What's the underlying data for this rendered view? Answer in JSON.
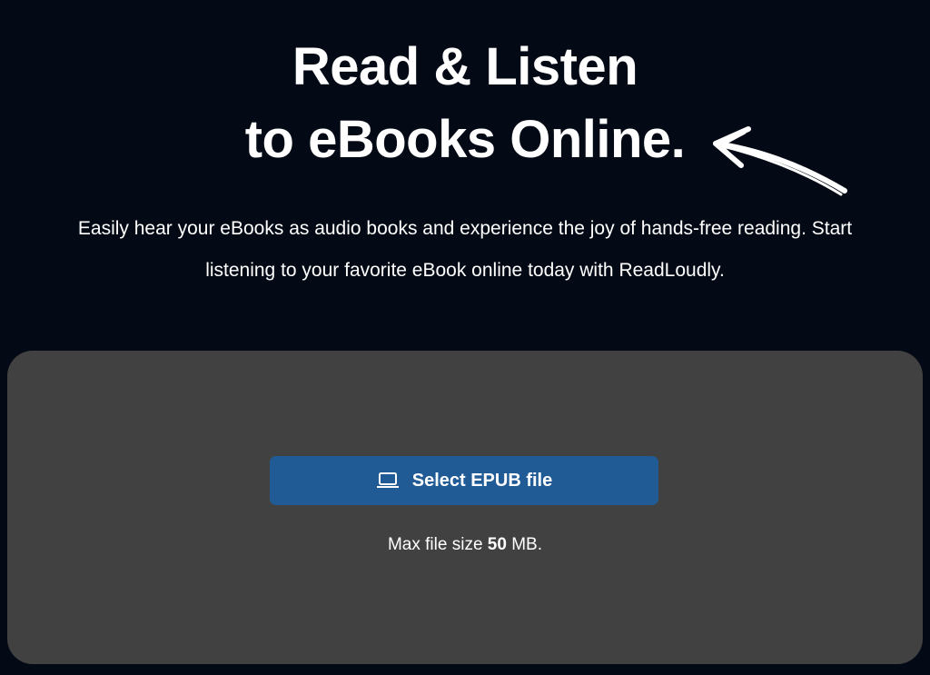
{
  "hero": {
    "headline_line1": "Read & Listen",
    "headline_line2": "to eBooks Online.",
    "arrow_icon": "hand-drawn-arrow-icon",
    "subtitle_line1": "Easily hear your eBooks as audio books and experience the joy of hands-free reading. Start",
    "subtitle_line2": "listening to your favorite eBook online today with ReadLoudly."
  },
  "upload": {
    "button_label": "Select EPUB file",
    "button_icon": "laptop-icon",
    "max_size_prefix": "Max file size",
    "max_size_value": "50",
    "max_size_unit": "MB."
  },
  "colors": {
    "background": "#040a15",
    "panel": "#414141",
    "button": "#215b96",
    "text": "#ffffff"
  }
}
